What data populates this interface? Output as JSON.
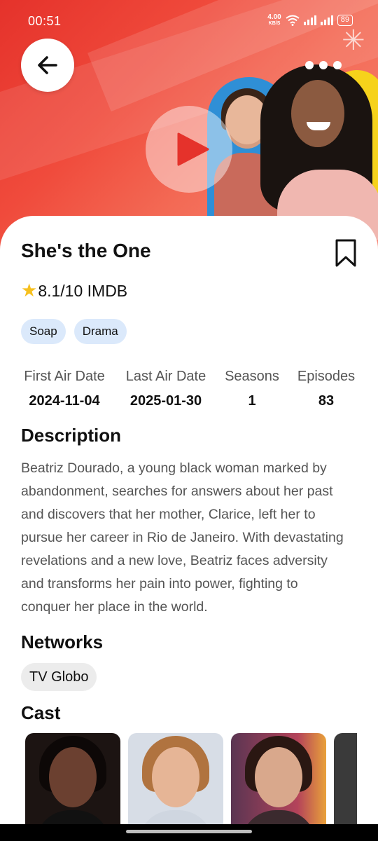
{
  "status_bar": {
    "time": "00:51",
    "net_speed": "4.00",
    "net_unit": "KB/S",
    "battery": "89"
  },
  "hero": {
    "back_icon": "arrow-left-icon",
    "more_icon": "more-dots-icon",
    "play_icon": "play-icon",
    "colors": {
      "primary": "#e5322b",
      "accent_play": "#e5322b"
    }
  },
  "show": {
    "title": "She's the One",
    "bookmark_icon": "bookmark-icon",
    "rating": "8.1/10 IMDB",
    "rating_icon": "star-icon",
    "genres": [
      "Soap",
      "Drama"
    ]
  },
  "stats": [
    {
      "label": "First Air Date",
      "value": "2024-11-04"
    },
    {
      "label": "Last Air Date",
      "value": "2025-01-30"
    },
    {
      "label": "Seasons",
      "value": "1"
    },
    {
      "label": "Episodes",
      "value": "83"
    }
  ],
  "description": {
    "heading": "Description",
    "lines": [
      "Beatriz Dourado, a young black woman marked by",
      "abandonment, searches for answers about her past",
      "and discovers that her mother, Clarice, left her to",
      "pursue her career in Rio de Janeiro. With devastating",
      "revelations and a new love, Beatriz faces adversity",
      "and transforms her pain into power, fighting to",
      "conquer her place in the world."
    ]
  },
  "networks": {
    "heading": "Networks",
    "items": [
      "TV Globo"
    ]
  },
  "cast": {
    "heading": "Cast"
  }
}
